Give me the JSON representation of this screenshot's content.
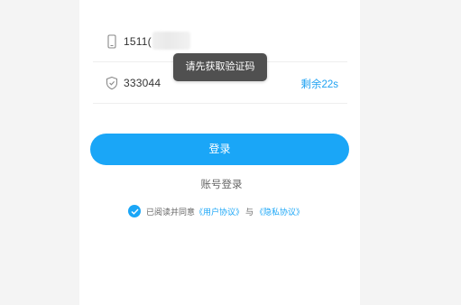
{
  "form": {
    "phone_value": "1511(",
    "code_value": "333044",
    "countdown": "剩余22s"
  },
  "toast": {
    "message": "请先获取验证码"
  },
  "login_button": {
    "label": "登录"
  },
  "account_login": {
    "label": "账号登录"
  },
  "agreement": {
    "prefix": "已阅读并同意",
    "user_agreement": "《用户协议》",
    "conjunction": "与",
    "privacy_agreement": "《隐私协议》",
    "checked": true
  },
  "icons": {
    "phone": "phone-icon",
    "code": "shield-icon",
    "check": "checkmark-icon"
  },
  "colors": {
    "accent": "#1aa6f7",
    "toast_bg": "#505050",
    "text": "#333333",
    "muted": "#666666"
  }
}
